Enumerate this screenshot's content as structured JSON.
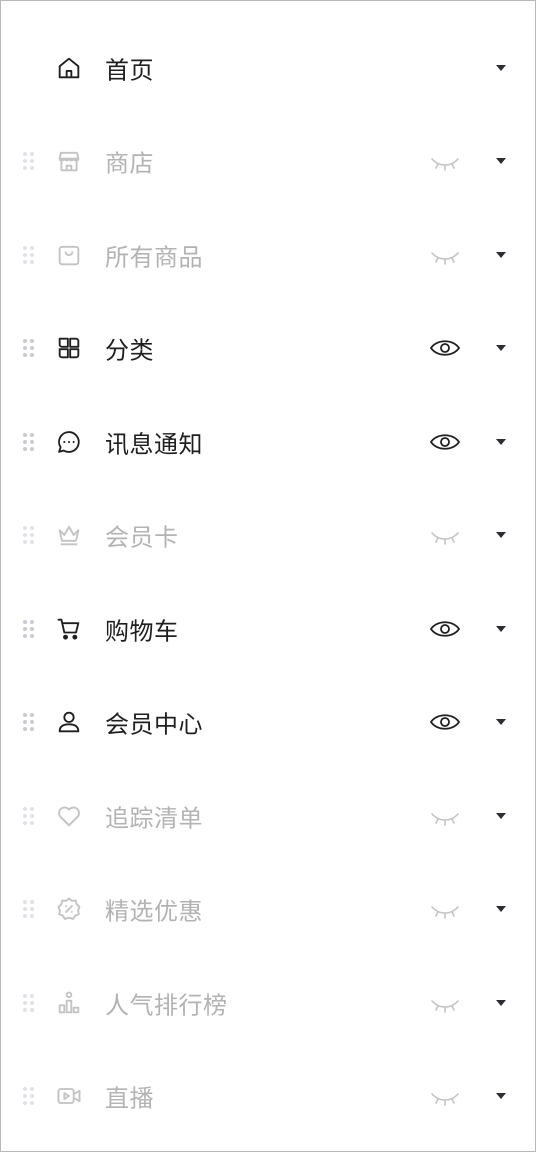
{
  "menu": {
    "items": [
      {
        "label": "首页",
        "icon": "home-icon",
        "visible": true,
        "draggable": false,
        "toggle": false
      },
      {
        "label": "商店",
        "icon": "store-icon",
        "visible": false,
        "draggable": true,
        "toggle": true
      },
      {
        "label": "所有商品",
        "icon": "shopping-bag-icon",
        "visible": false,
        "draggable": true,
        "toggle": true
      },
      {
        "label": "分类",
        "icon": "category-grid-icon",
        "visible": true,
        "draggable": true,
        "toggle": true
      },
      {
        "label": "讯息通知",
        "icon": "message-icon",
        "visible": true,
        "draggable": true,
        "toggle": true
      },
      {
        "label": "会员卡",
        "icon": "crown-icon",
        "visible": false,
        "draggable": true,
        "toggle": true
      },
      {
        "label": "购物车",
        "icon": "cart-icon",
        "visible": true,
        "draggable": true,
        "toggle": true
      },
      {
        "label": "会员中心",
        "icon": "user-icon",
        "visible": true,
        "draggable": true,
        "toggle": true
      },
      {
        "label": "追踪清单",
        "icon": "heart-icon",
        "visible": false,
        "draggable": true,
        "toggle": true
      },
      {
        "label": "精选优惠",
        "icon": "discount-badge-icon",
        "visible": false,
        "draggable": true,
        "toggle": true
      },
      {
        "label": "人气排行榜",
        "icon": "ranking-icon",
        "visible": false,
        "draggable": true,
        "toggle": true
      },
      {
        "label": "直播",
        "icon": "video-icon",
        "visible": false,
        "draggable": true,
        "toggle": true
      }
    ]
  },
  "colors": {
    "text_active": "#1f1f1f",
    "text_hidden": "#b3b3b3",
    "icon_hidden": "#c3c3c3",
    "caret": "#2b2f33",
    "drag_handle": "#c7ccd2"
  }
}
